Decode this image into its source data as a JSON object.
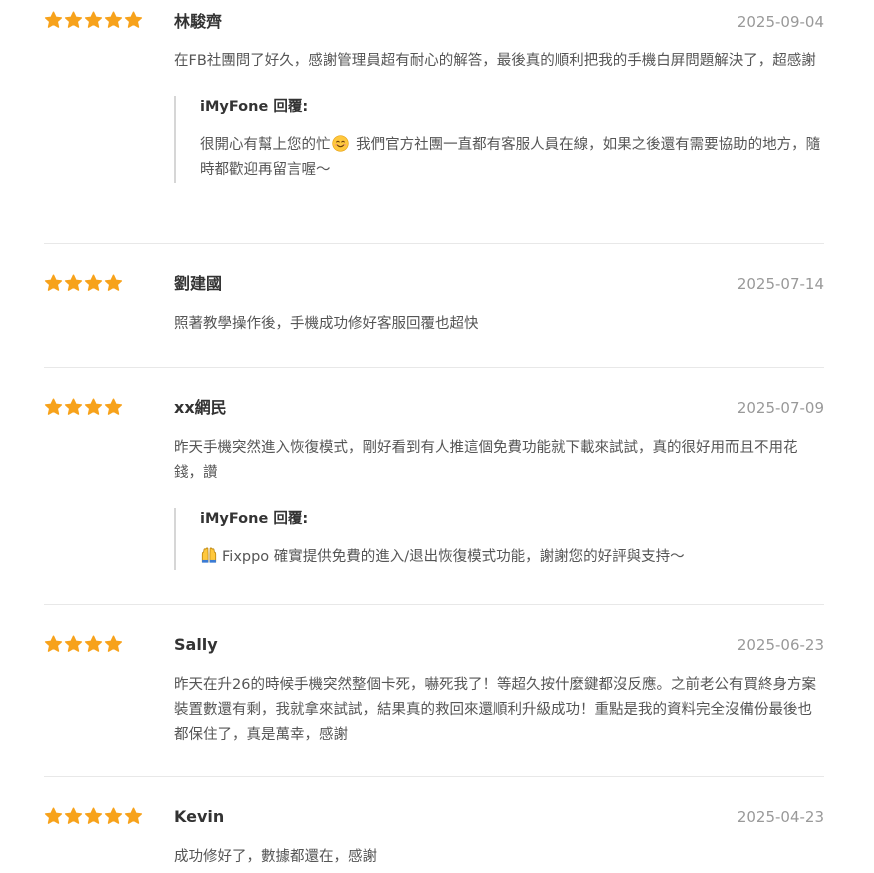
{
  "reviews": [
    {
      "author": "林駿齊",
      "date": "2025-09-04",
      "rating": 5,
      "text": "在FB社團問了好久，感謝管理員超有耐心的解答，最後真的順利把我的手機白屏問題解決了，超感謝",
      "reply": {
        "author": "iMyFone 回覆:",
        "text_before": "很開心有幫上您的忙",
        "emoji": "smiling-face-icon",
        "text_after": " 我們官方社團一直都有客服人員在線，如果之後還有需要協助的地方，隨時都歡迎再留言喔～"
      }
    },
    {
      "author": "劉建國",
      "date": "2025-07-14",
      "rating": 4,
      "text": "照著教學操作後，手機成功修好客服回覆也超快"
    },
    {
      "author": "xx網民",
      "date": "2025-07-09",
      "rating": 4,
      "text": "昨天手機突然進入恢復模式，剛好看到有人推這個免費功能就下載來試試，真的很好用而且不用花錢，讚",
      "reply": {
        "author": "iMyFone 回覆:",
        "emoji": "raising-hands-icon",
        "text_after": "Fixppo 確實提供免費的進入/退出恢復模式功能，謝謝您的好評與支持～"
      }
    },
    {
      "author": "Sally",
      "date": "2025-06-23",
      "rating": 4,
      "text": "昨天在升26的時候手機突然整個卡死，嚇死我了！等超久按什麼鍵都沒反應。之前老公有買終身方案裝置數還有剩，我就拿來試試，結果真的救回來還順利升級成功！重點是我的資料完全沒備份最後也都保住了，真是萬幸，感謝"
    },
    {
      "author": "Kevin",
      "date": "2025-04-23",
      "rating": 5,
      "text": "成功修好了，數據都還在，感謝"
    }
  ],
  "colors": {
    "star": "#f7a21b",
    "date": "#999999",
    "divider": "#e8e8e8"
  }
}
